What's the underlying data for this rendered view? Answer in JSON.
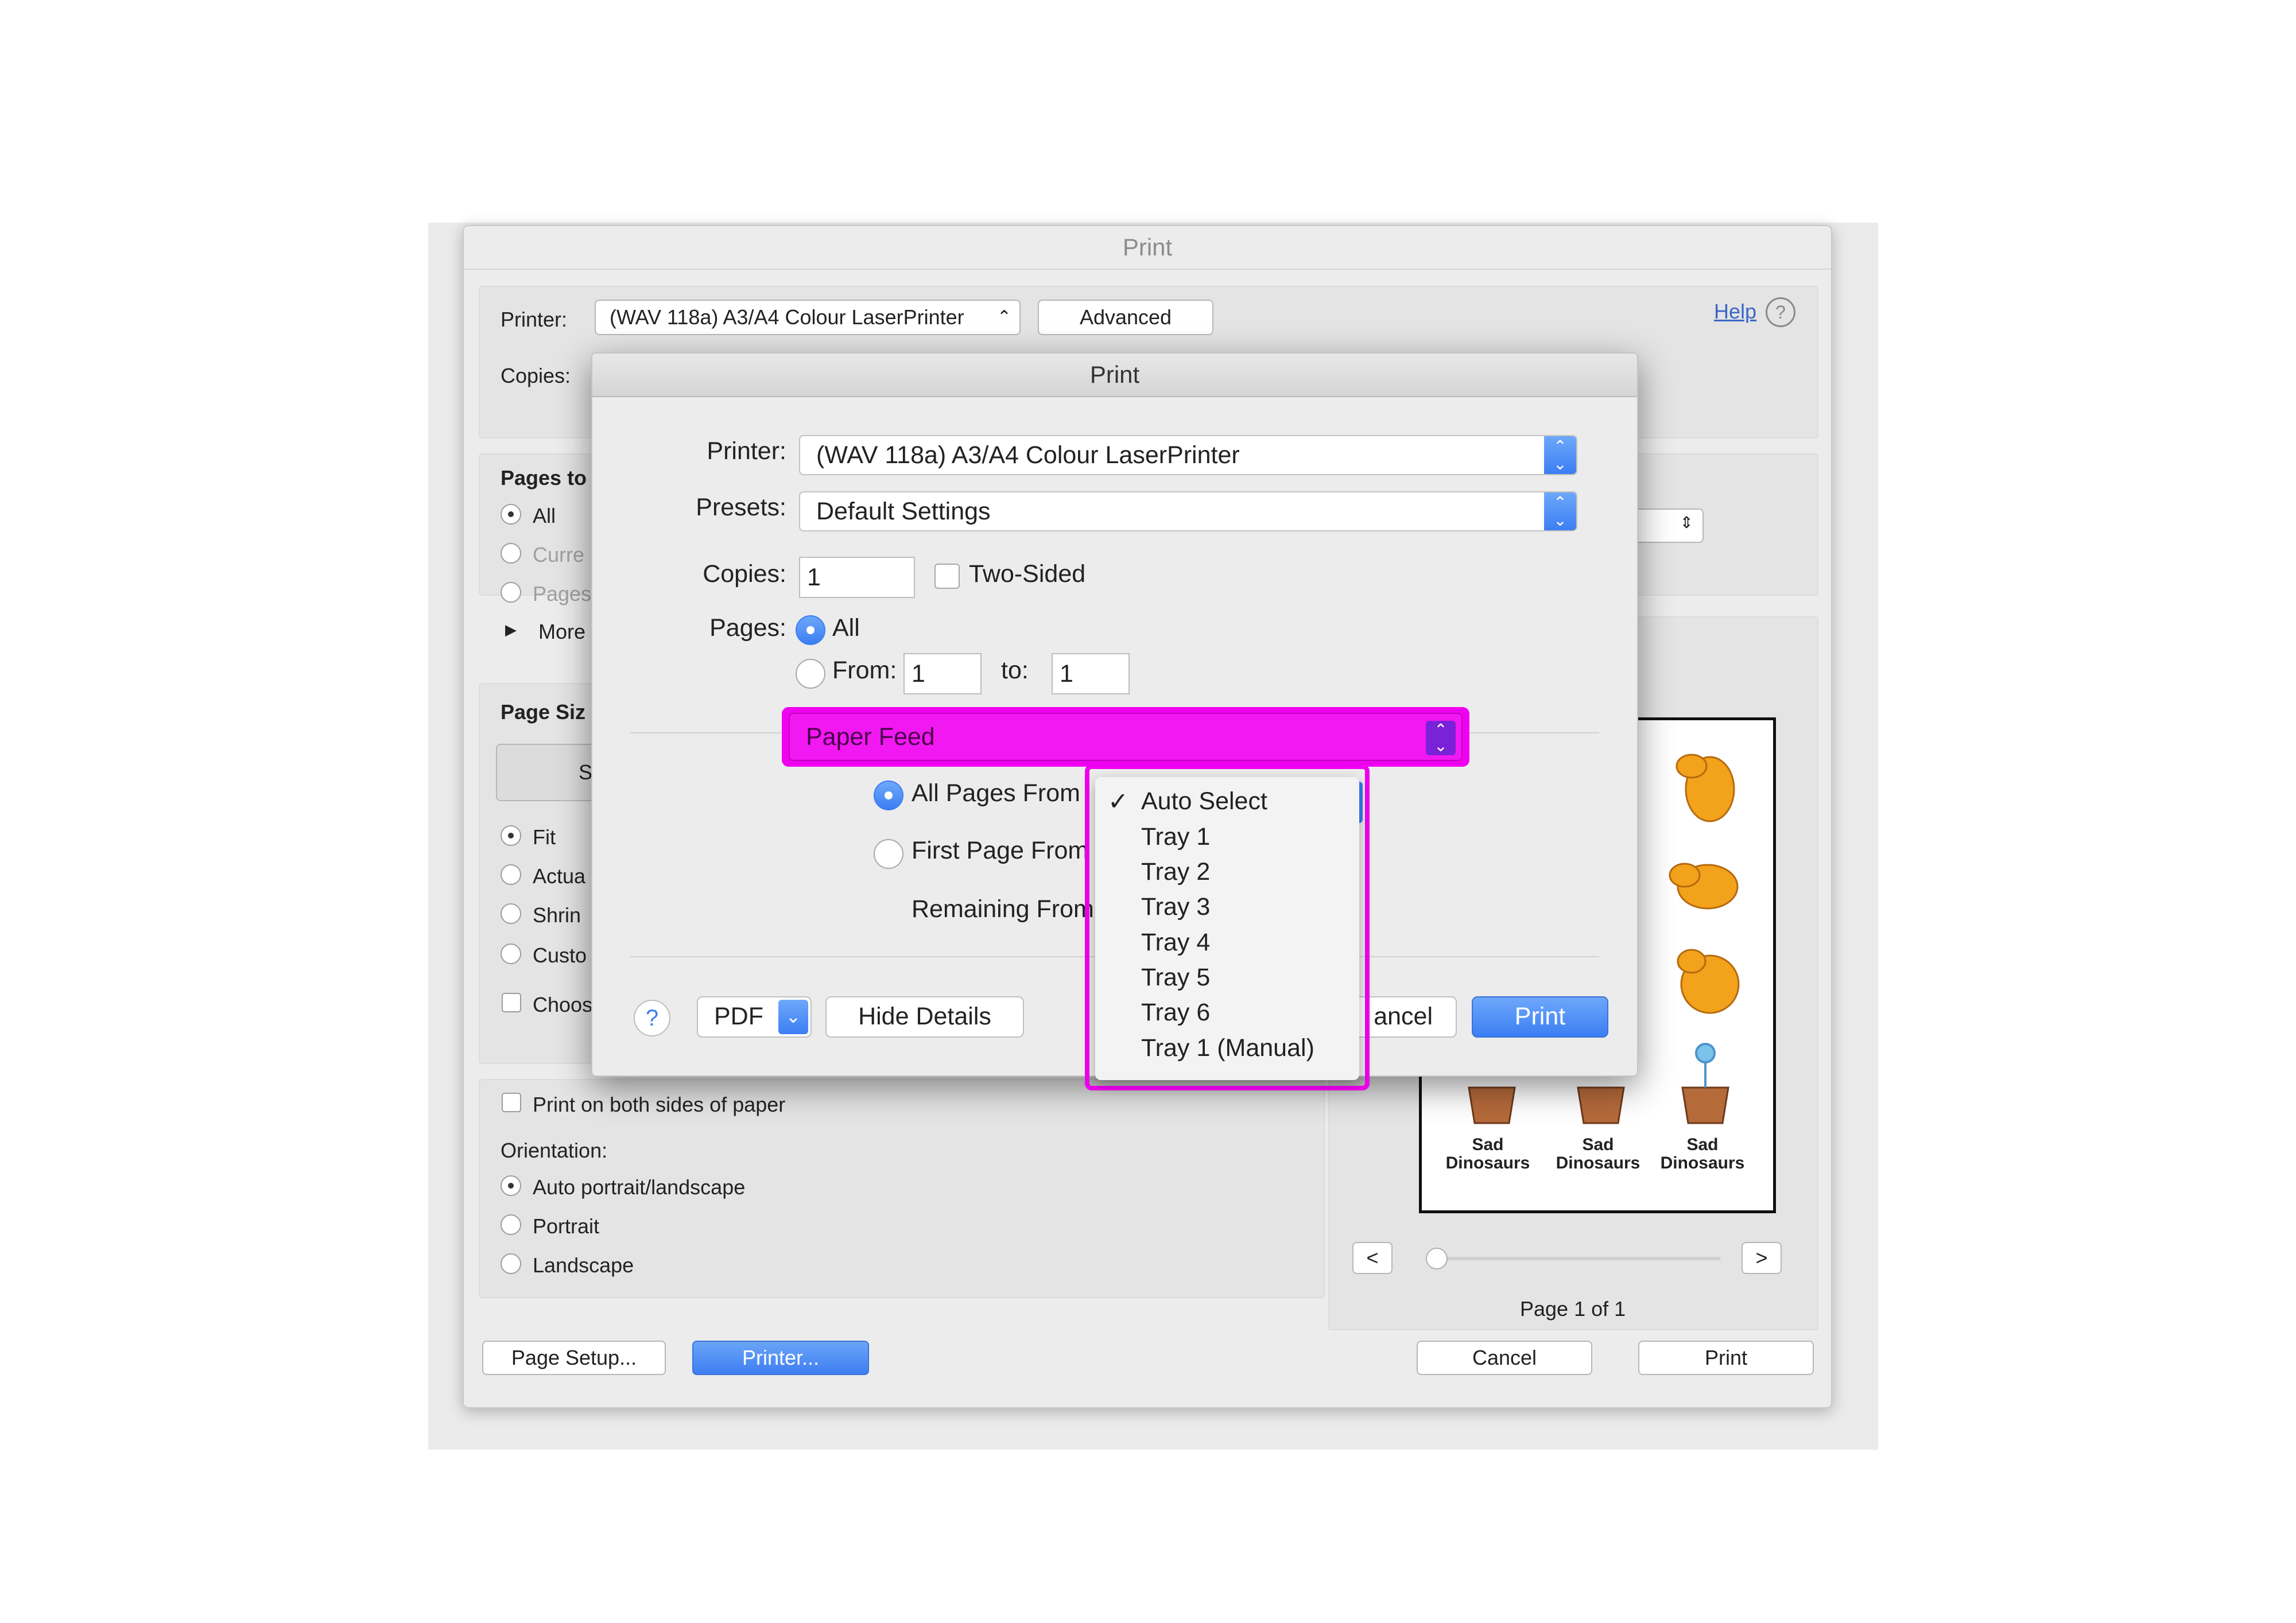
{
  "back_window": {
    "title": "Print",
    "printer_label": "Printer:",
    "printer_value": "(WAV 118a) A3/A4 Colour LaserPrinter",
    "advanced_button": "Advanced",
    "help_link": "Help",
    "help_icon": "?",
    "copies_label": "Copies:",
    "pages_heading": "Pages to",
    "pages_options": [
      "All",
      "Curre",
      "Pages"
    ],
    "more_label": "More",
    "page_size_heading": "Page Siz",
    "size_tab": "Si",
    "scaling_options": [
      "Fit",
      "Actua",
      "Shrin",
      "Custo"
    ],
    "choose_label": "Choos",
    "print_both_sides": "Print on both sides of paper",
    "orientation_label": "Orientation:",
    "orientation_options": [
      "Auto portrait/landscape",
      "Portrait",
      "Landscape"
    ],
    "preview_captions": [
      "Sad",
      "Dinosaurs"
    ],
    "prev_button": "<",
    "next_button": ">",
    "page_counter": "Page 1 of 1",
    "page_setup_button": "Page Setup...",
    "printer_button": "Printer...",
    "cancel_button": "Cancel",
    "print_button": "Print"
  },
  "sheet": {
    "title": "Print",
    "printer_label": "Printer:",
    "printer_value": "(WAV 118a) A3/A4 Colour LaserPrinter",
    "presets_label": "Presets:",
    "presets_value": "Default Settings",
    "copies_label": "Copies:",
    "copies_value": "1",
    "two_sided_label": "Two-Sided",
    "pages_label": "Pages:",
    "pages_all": "All",
    "pages_from": "From:",
    "from_value": "1",
    "to_label": "to:",
    "to_value": "1",
    "panel_popup": "Paper Feed",
    "all_pages_from": "All Pages From",
    "first_page_from": "First Page From",
    "remaining_from": "Remaining From",
    "help_button": "?",
    "pdf_button": "PDF",
    "hide_details_button": "Hide Details",
    "cancel_button_partial": "ancel",
    "print_button": "Print"
  },
  "paper_source_menu": {
    "selected": "Auto Select",
    "items": [
      "Auto Select",
      "Tray 1",
      "Tray 2",
      "Tray 3",
      "Tray 4",
      "Tray 5",
      "Tray 6",
      "Tray 1 (Manual)"
    ]
  },
  "colors": {
    "highlight": "#f000f0",
    "accent": "#3c7ef3"
  }
}
